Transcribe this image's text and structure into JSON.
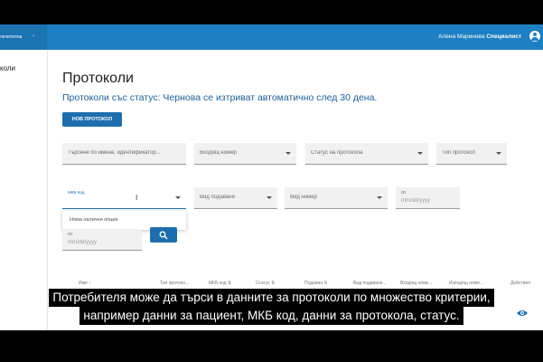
{
  "sidebar": {
    "logo_text": "лечителна",
    "items": [
      {
        "label": "коли"
      }
    ]
  },
  "header": {
    "user_name": "Алена Маринова",
    "user_role": "Специалист",
    "account_icon": "account-circle-icon",
    "accent_color": "#1e7fc3"
  },
  "main": {
    "title": "Протоколи",
    "subtitle": "Протоколи със статус: Чернова се изтриват автоматично след 30 дена.",
    "new_protocol_label": "НОВ ПРОТОКОЛ"
  },
  "filters": {
    "search_placeholder": "Търсене по имена, идентификатор...",
    "incoming_number": "Входящ номер",
    "protocol_status": "Статус на протокола",
    "protocol_type": "Тип протокол",
    "mkb_code_label": "МКБ Код",
    "submission_type": "Вид подаване",
    "number_type": "Вид номер",
    "date_from_label": "От",
    "date_from_value": "mm/dd/yyyy",
    "date_to_label": "От",
    "date_to_value": "mm/dd/yyyy",
    "no_options": "Няма налични опции",
    "search_icon": "search-icon"
  },
  "table": {
    "columns": [
      {
        "label": "Име ↑"
      },
      {
        "label": "Тип протоко..."
      },
      {
        "label": "МКБ код ⇅"
      },
      {
        "label": "Статус ⇅"
      },
      {
        "label": "Подаван ⇅"
      },
      {
        "label": "Вид подаване..."
      },
      {
        "label": "Входящ номе..."
      },
      {
        "label": "Изходящ номе..."
      },
      {
        "label": "Действия"
      }
    ],
    "row_action_icon": "eye-icon"
  },
  "caption": {
    "line1": "Потребителя може да търси в  данните за протоколи по множество критерии,",
    "line2": "например данни за пациент, МКБ код, данни за протокола, статус."
  }
}
